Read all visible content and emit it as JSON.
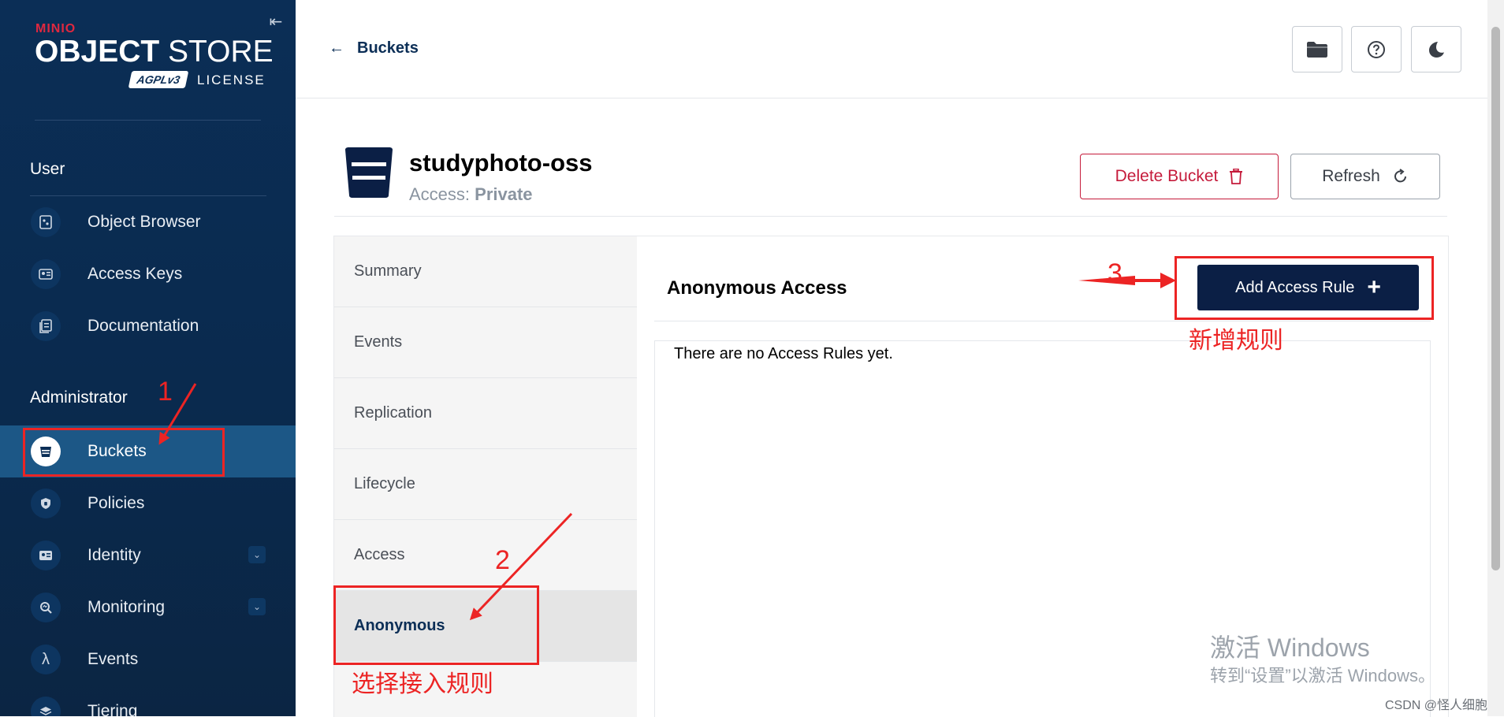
{
  "logo": {
    "brand": "MINIO",
    "title_bold": "OBJECT",
    "title_light": "STORE",
    "agpl": "AGPLv3",
    "license": "LICENSE"
  },
  "sidebar": {
    "collapse_icon": "collapse-left-icon",
    "user_section": "User",
    "user_items": [
      {
        "label": "Object Browser",
        "icon": "object-browser-icon"
      },
      {
        "label": "Access Keys",
        "icon": "access-keys-icon"
      },
      {
        "label": "Documentation",
        "icon": "documentation-icon"
      }
    ],
    "admin_section": "Administrator",
    "admin_items": [
      {
        "label": "Buckets",
        "icon": "bucket-icon",
        "active": true
      },
      {
        "label": "Policies",
        "icon": "policy-icon"
      },
      {
        "label": "Identity",
        "icon": "identity-icon",
        "expandable": true
      },
      {
        "label": "Monitoring",
        "icon": "monitoring-icon",
        "expandable": true
      },
      {
        "label": "Events",
        "icon": "lambda-icon"
      },
      {
        "label": "Tiering",
        "icon": "tiering-icon"
      }
    ]
  },
  "header": {
    "back_label": "Buckets",
    "buttons": [
      {
        "icon": "folder-icon"
      },
      {
        "icon": "help-icon"
      },
      {
        "icon": "dark-mode-icon"
      }
    ]
  },
  "bucket": {
    "name": "studyphoto-oss",
    "access_label": "Access:",
    "access_value": "Private",
    "delete_label": "Delete Bucket",
    "refresh_label": "Refresh"
  },
  "tabs": [
    {
      "label": "Summary"
    },
    {
      "label": "Events"
    },
    {
      "label": "Replication"
    },
    {
      "label": "Lifecycle"
    },
    {
      "label": "Access"
    },
    {
      "label": "Anonymous",
      "active": true
    }
  ],
  "content": {
    "title": "Anonymous Access",
    "add_rule_label": "Add Access Rule",
    "empty_message": "There are no Access Rules yet."
  },
  "annotations": {
    "n1": "1",
    "n2": "2",
    "n3": "3",
    "add_rule_note": "新增规则",
    "select_note": "选择接入规则",
    "color": "#ec2424"
  },
  "watermark": {
    "activate_title": "激活 Windows",
    "activate_sub": "转到“设置”以激活 Windows。",
    "csdn": "CSDN @怪人细胞"
  },
  "colors": {
    "sidebar_bg": "#0b2e56",
    "sidebar_active": "#1c5786",
    "primary_dark": "#0b1f45",
    "danger": "#c51b3b",
    "brand_red": "#e0283f"
  }
}
